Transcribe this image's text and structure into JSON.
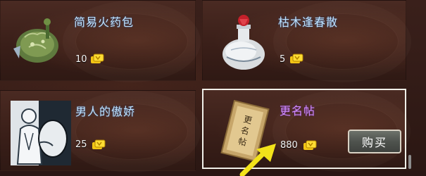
{
  "shop": {
    "items": [
      {
        "name": "简易火药包",
        "price": "10",
        "icon": "gunpowder-pouch-icon",
        "name_color": "#bfe3ff"
      },
      {
        "name": "枯木逢春散",
        "price": "5",
        "icon": "porcelain-bottle-icon",
        "name_color": "#bfe3ff"
      },
      {
        "name": "男人的傲娇",
        "price": "25",
        "icon": "sketch-portrait-icon",
        "name_color": "#bfe3ff"
      },
      {
        "name": "更名帖",
        "price": "880",
        "icon": "rename-scroll-icon",
        "name_color": "#d08cff",
        "selected": true
      }
    ],
    "buy_label": "购买",
    "currency_icon": "gold-coin-icon"
  },
  "colors": {
    "panel_bg": "#2b1713",
    "selected_border": "#f0efe8",
    "annotation_arrow": "#f2e21a"
  }
}
